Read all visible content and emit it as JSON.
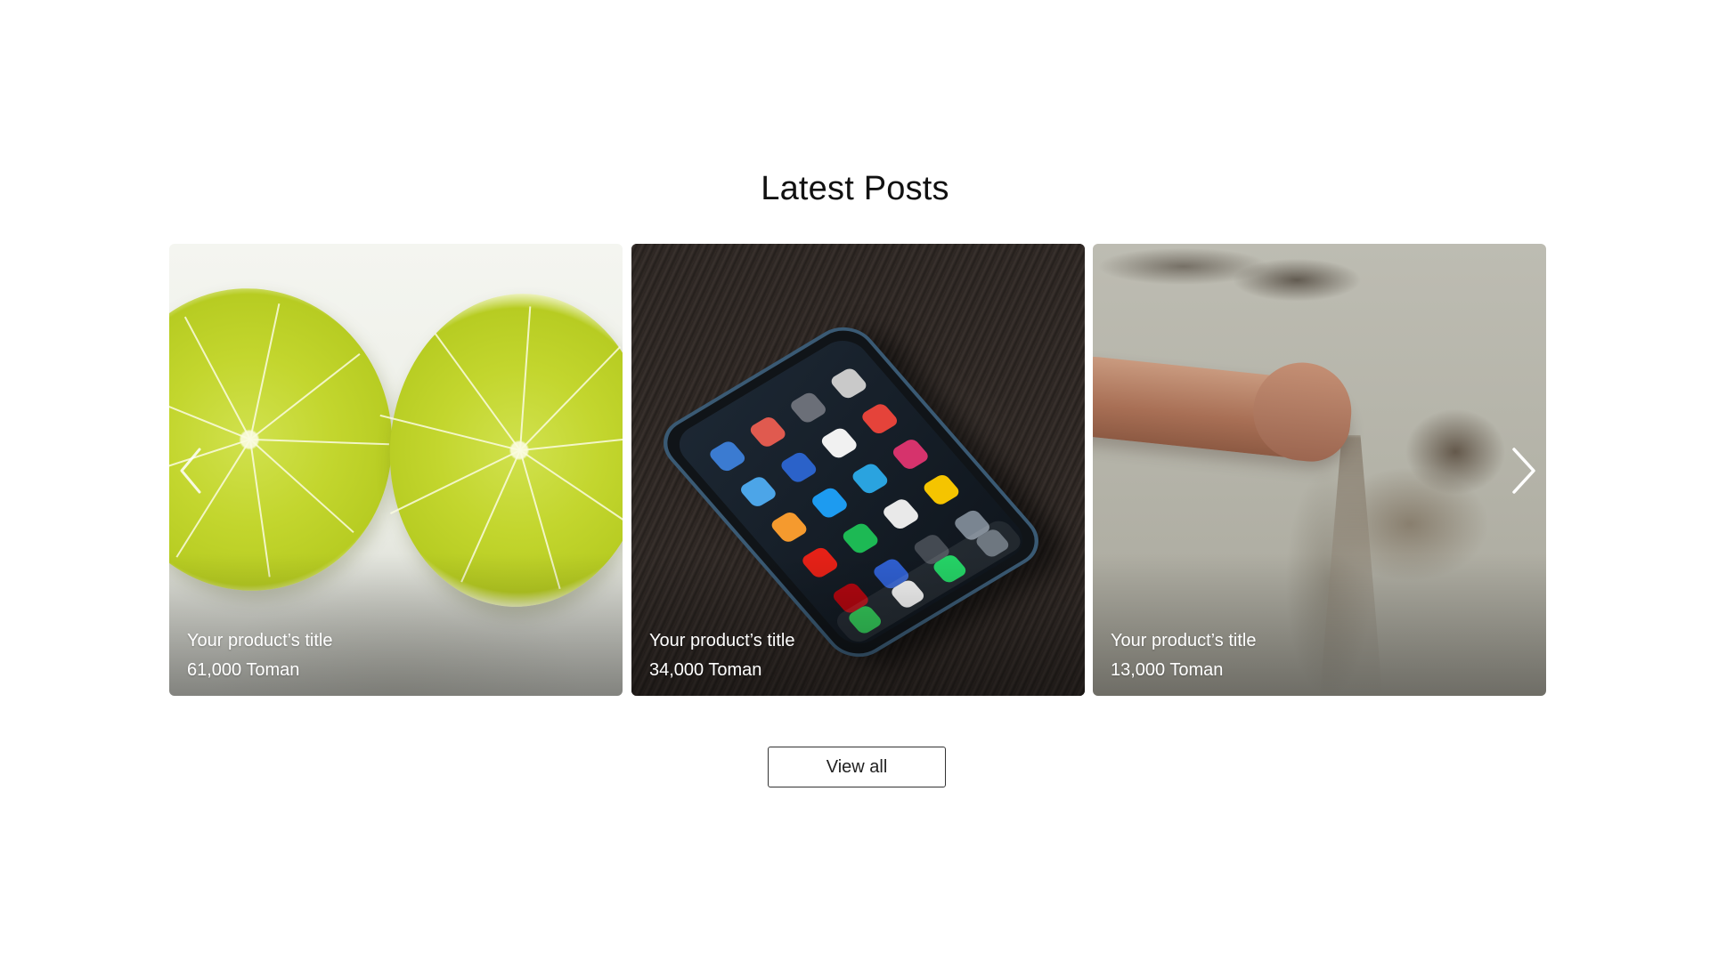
{
  "section": {
    "title": "Latest Posts",
    "view_all_label": "View all"
  },
  "carousel": {
    "prev_icon": "chevron-left-icon",
    "next_icon": "chevron-right-icon",
    "items": [
      {
        "title": "Your product’s title",
        "price": "61,000 Toman",
        "image": "limes-photo"
      },
      {
        "title": "Your product’s title",
        "price": "34,000 Toman",
        "image": "smartphone-photo"
      },
      {
        "title": "Your product’s title",
        "price": "13,000 Toman",
        "image": "hand-sand-photo"
      }
    ]
  },
  "colors": {
    "text": "#111111",
    "caption": "#ffffff",
    "button_border": "#333333",
    "background": "#ffffff"
  }
}
